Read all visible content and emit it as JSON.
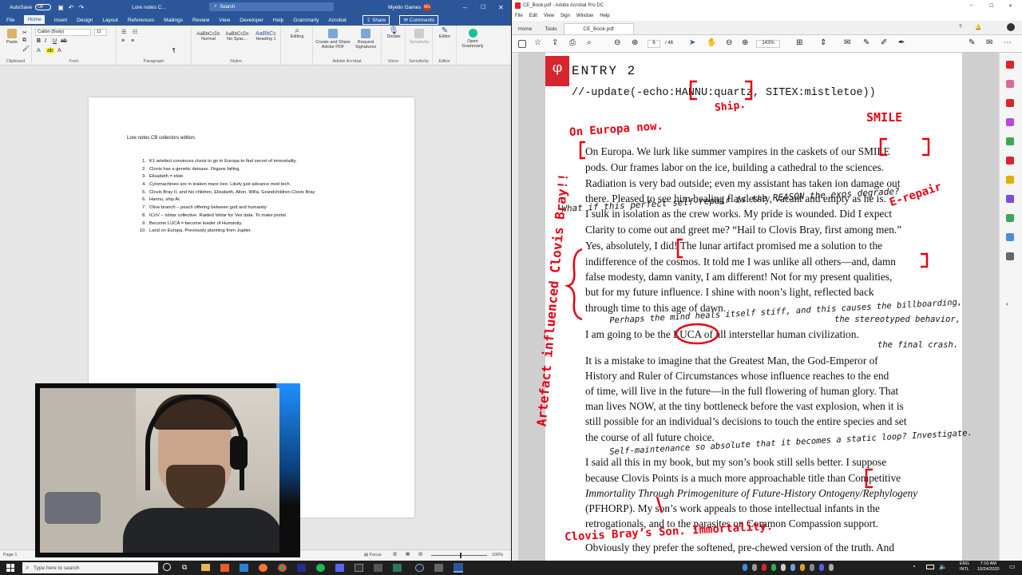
{
  "word": {
    "autosave_label": "AutoSave",
    "autosave_state": "Off",
    "doc_title": "Lore notes C...",
    "search_placeholder": "Search",
    "user": "Myelin Games",
    "user_initials": "MG",
    "menu": [
      "File",
      "Home",
      "Insert",
      "Design",
      "Layout",
      "References",
      "Mailings",
      "Review",
      "View",
      "Developer",
      "Help",
      "Grammarly",
      "Acrobat"
    ],
    "share_label": "Share",
    "comments_label": "Comments",
    "ribbon": {
      "paste": "Paste",
      "font_name": "Calibri (Body)",
      "font_size": "11",
      "styles": [
        "Normal",
        "No Spac...",
        "Heading 1"
      ],
      "style_preview": "AaBbCcDc",
      "style_preview_heading": "AaBbCc",
      "editing": "Editing",
      "create_share": "Create and Share Adobe PDF",
      "request_sign": "Request Signatures",
      "dictate": "Dictate",
      "sensitivity": "Sensitivity",
      "editor": "Editor",
      "grammarly": "Open Grammarly",
      "groups": [
        "Clipboard",
        "Font",
        "Paragraph",
        "Styles",
        "Adobe Acrobat",
        "Voice",
        "Sensitivity",
        "Editor"
      ]
    },
    "document": {
      "title_line": "Lore notes CB collectors edition.",
      "items": [
        "K1 artefact convinces clvois to go to Europa to find secret of immortality.",
        "Clovis has a genetic deisase. Organs failing.",
        "Elisabeth = elsie",
        "Cytomachines are in kraken mare lore. Likely just advance med tech.",
        "Clovis Bray II, and his children. Elisabeth, Alton, Willa. Grandchildren Clovis Bray",
        "Hannu, ship AI.",
        "Olive branch – peach offering between god and humanity",
        "ICoV – Ishtar collective. Raided Ishtar for Vex data. To make portal.",
        "Become LUCA = become leader of Humanity.",
        "Land on Europa. Previously planning from Jupiter."
      ]
    },
    "status": {
      "page": "Page 1",
      "focus": "Focus",
      "zoom": "100%"
    }
  },
  "acrobat": {
    "title": "CE_Book.pdf - Adobe Acrobat Pro DC",
    "menu": [
      "File",
      "Edit",
      "View",
      "Sign",
      "Window",
      "Help"
    ],
    "tabs": [
      "Home",
      "Tools",
      "CE_Book.pdf"
    ],
    "page_current": "6",
    "page_total": "/ 46",
    "zoom": "143%",
    "page": {
      "entry_heading": "ENTRY 2",
      "code_line": "//-update(-echo:HANNU:quartz, SITEX:mistletoe))",
      "lines": [
        "On Europa. We lurk like summer vampires in the caskets of our SMILE",
        "pods. Our frames labor on the ice, building a cathedral to the sciences.",
        "Radiation is very bad outside; even my assistant has taken ion damage out",
        "there. Pleased to see him healing flawlessly, vacant and empty as he is.",
        "I sulk in isolation as the crew works. My pride is wounded. Did I expect",
        "Clarity to come out and greet me? “Hail to Clovis Bray, first among men.”",
        "Yes, absolutely, I did! The lunar artifact promised me a solution to the",
        "indifference of the cosmos. It told me I was unlike all others—and, damn",
        "false modesty, damn vanity, I am different! Not for my present qualities,",
        "but for my future influence. I shine with noon’s light, reflected back",
        "through time to this age of dawn.",
        "I am going to be the LUCA of all interstellar human civilization.",
        "It is a mistake to imagine that the Greatest Man, the God-Emperor of",
        "History and Ruler of Circumstances whose influence reaches to the end",
        "of time, will live in the future—in the full flowering of human glory. That",
        "man lives NOW, at the tiny bottleneck before the vast explosion, when it is",
        "still possible for an individual’s decisions to touch the entire species and set",
        "the course of all future choice.",
        "I said all this in my book, but my son’s book still sells better. I suppose",
        "because Clovis Points is a much more approachable title than Competitive",
        "Immortality Through Primogeniture of Future-History Ontogeny/Rephylogeny",
        "(PFHORP). My son’s work appeals to those intellectual infants in the",
        "retrogationals, and to the parasites on Common Compassion support.",
        "Obviously they prefer the softened, pre-chewed version of the truth. And"
      ],
      "annotations": {
        "on_europa_now": "On Europa now.",
        "ship": "Ship.",
        "smile": "SMILE",
        "self_repair_q": "What if this perfect self-repair is the REASON the exos degrade?",
        "e_repair": "E-repair",
        "vertical_left": "Artefact influenced Clovis Bray!!",
        "mind_heals": "Perhaps the mind heals itself stiff, and this causes the billboarding,",
        "stereotyped": "the stereotyped behavior,",
        "final_crash": "the final crash.",
        "self_maintenance": "Self-maintenance so absolute that it becomes a static loop? Investigate.",
        "clovis_son": "Clovis Bray’s Son. Immortality."
      }
    }
  },
  "taskbar": {
    "search_placeholder": "Type here to search",
    "lang": "ENG",
    "intl": "INTL",
    "time": "7:10 AM",
    "date": "10/24/2020"
  },
  "colors": {
    "word_blue": "#2b579a",
    "annotation_red": "#e60012",
    "acrobat_red": "#d7262e"
  }
}
